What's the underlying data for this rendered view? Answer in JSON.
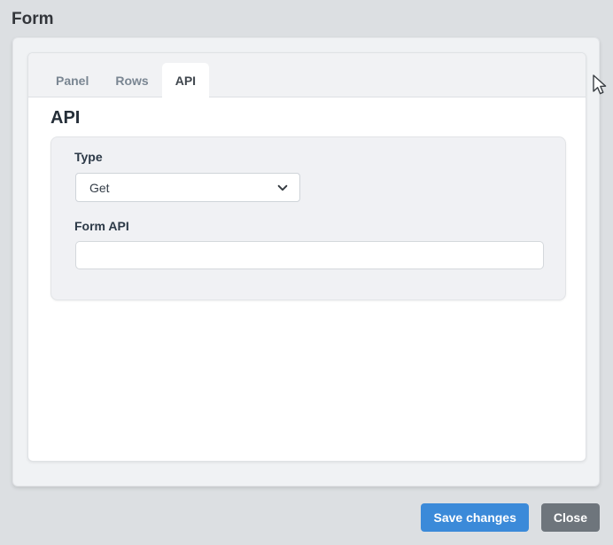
{
  "page": {
    "title": "Form"
  },
  "modal": {
    "tabs": [
      {
        "label": "Panel",
        "active": false
      },
      {
        "label": "Rows",
        "active": false
      },
      {
        "label": "API",
        "active": true
      }
    ],
    "content": {
      "heading": "API",
      "fields": {
        "type": {
          "label": "Type",
          "value": "Get"
        },
        "form_api": {
          "label": "Form API",
          "value": "",
          "placeholder": ""
        }
      }
    },
    "footer": {
      "save_label": "Save changes",
      "close_label": "Close"
    }
  },
  "icons": {
    "select_chevron": "chevron-down-icon",
    "pointer": "mouse-cursor-arrow"
  },
  "colors": {
    "page_background": "#dcdfe2",
    "outer_card": "#f0f2f4",
    "inner_card": "#ffffff",
    "tab_strip": "#f1f2f4",
    "field_panel": "#f0f1f4",
    "inactive_tab_text": "#7a8692",
    "active_tab_text": "#40474e",
    "heading_text": "#252e38",
    "label_text": "#2c3947",
    "primary_button": "#3b8ad9",
    "secondary_button": "#6e757c",
    "button_text": "#ffffff"
  }
}
